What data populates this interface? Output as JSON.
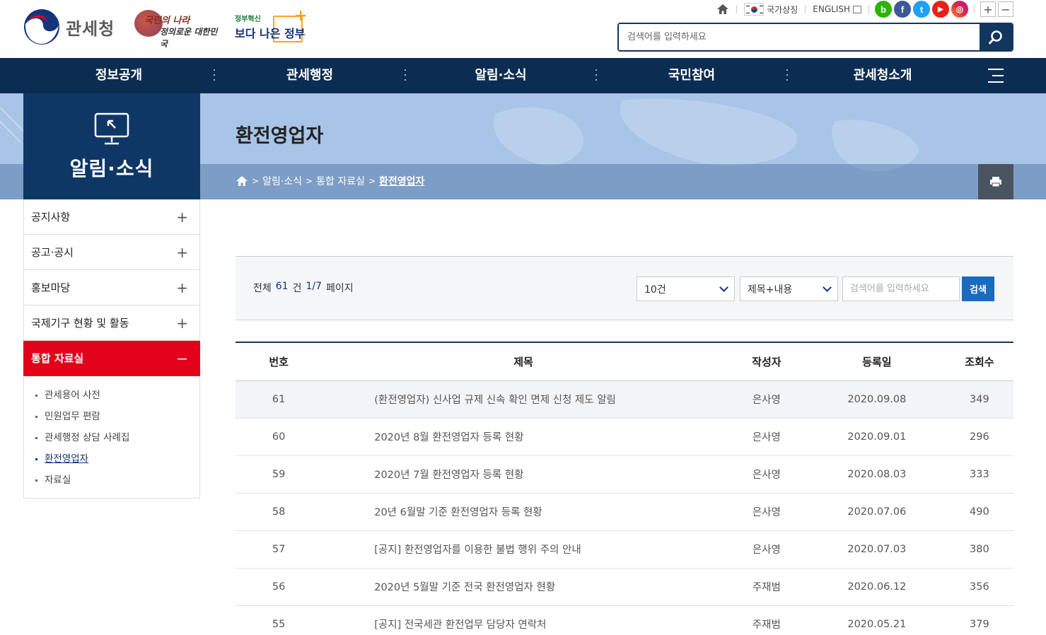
{
  "header": {
    "logo_text": "관세청",
    "slogan1_top": "국민의 나라",
    "slogan1_bottom": "정의로운 대한민국",
    "slogan2_top": "정부혁신",
    "slogan2_bottom": "보다 나은 정부",
    "utility": {
      "national_symbol": "국가상징",
      "english": "ENGLISH"
    },
    "sns": [
      "b",
      "f",
      "t",
      "▶",
      "◎"
    ],
    "search_placeholder": "검색어를 입력하세요"
  },
  "gnb": {
    "items": [
      "정보공개",
      "관세행정",
      "알림·소식",
      "국민참여",
      "관세청소개"
    ]
  },
  "lnb": {
    "title": "알림·소식",
    "items": [
      {
        "label": "공지사항",
        "toggle": "+"
      },
      {
        "label": "공고·공시",
        "toggle": "+"
      },
      {
        "label": "홍보마당",
        "toggle": "+"
      },
      {
        "label": "국제기구 현황 및 활동",
        "toggle": "+"
      },
      {
        "label": "통합 자료실",
        "toggle": "−"
      }
    ],
    "sub_items": [
      "관세용어 사전",
      "민원업무 편람",
      "관세행정 상담 사례집",
      "환전영업자",
      "자료실"
    ]
  },
  "page": {
    "title": "환전영업자",
    "breadcrumb": [
      "알림·소식",
      "통합 자료실",
      "환전영업자"
    ]
  },
  "board": {
    "total_label": "전체",
    "total_count": "61",
    "unit": "건",
    "page_info": "1/7",
    "page_label": "페이지",
    "per_page": "10건",
    "search_type": "제목+내용",
    "keyword_placeholder": "검색어를 입력하세요",
    "search_button": "검색",
    "columns": [
      "번호",
      "제목",
      "작성자",
      "등록일",
      "조회수"
    ],
    "rows": [
      {
        "no": "61",
        "title": "(환전영업자) 신사업 규제 신속 확인 면제 신청 제도 알림",
        "writer": "은사영",
        "date": "2020.09.08",
        "views": "349"
      },
      {
        "no": "60",
        "title": "2020년 8월 환전영업자 등록 현황",
        "writer": "은사영",
        "date": "2020.09.01",
        "views": "296"
      },
      {
        "no": "59",
        "title": "2020년 7월 환전영업자 등록 현황",
        "writer": "은사영",
        "date": "2020.08.03",
        "views": "333"
      },
      {
        "no": "58",
        "title": "20년 6월말 기준 환전영업자 등록 현황",
        "writer": "은사영",
        "date": "2020.07.06",
        "views": "490"
      },
      {
        "no": "57",
        "title": "[공지] 환전영업자를 이용한 불법 행위 주의 안내",
        "writer": "은사영",
        "date": "2020.07.03",
        "views": "380"
      },
      {
        "no": "56",
        "title": "2020년 5월말 기준 전국 환전영업자 현황",
        "writer": "주재범",
        "date": "2020.06.12",
        "views": "356"
      },
      {
        "no": "55",
        "title": "[공지] 전국세관 환전업무 담당자 연락처",
        "writer": "주재범",
        "date": "2020.05.21",
        "views": "379"
      }
    ]
  }
}
